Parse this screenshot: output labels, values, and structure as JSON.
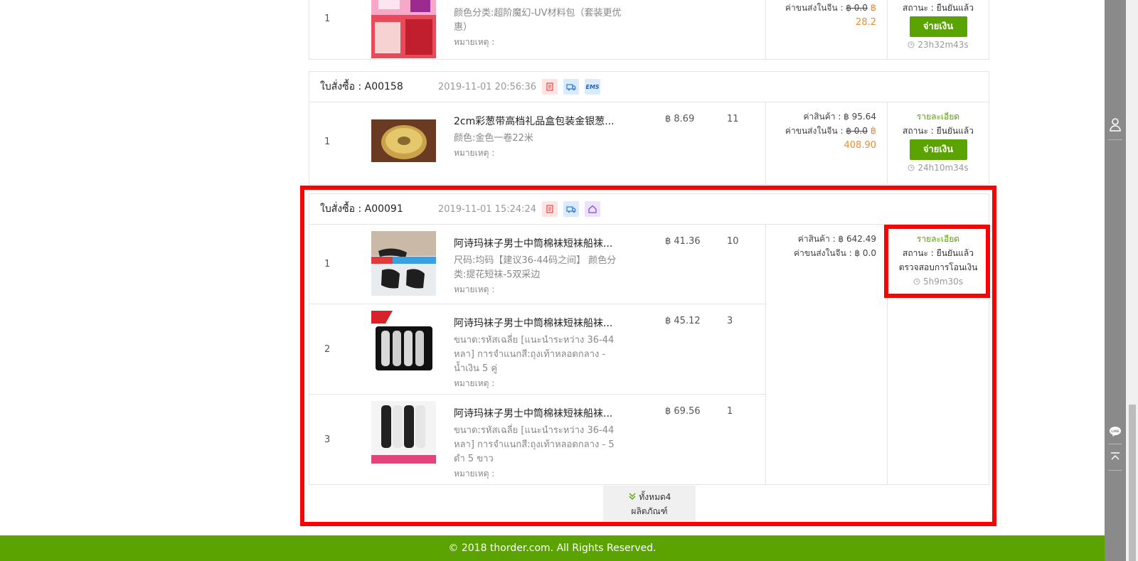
{
  "orders": [
    {
      "items": [
        {
          "index": "1",
          "attr": "颜色分类:超阶魔幻-UV材料包（套装更优惠）",
          "note": "หมายเหตุ :"
        }
      ],
      "amount": {
        "shipping_label": "ค่าขนส่งในจีน :",
        "shipping_old": "฿ 0.0",
        "shipping_currency": "฿",
        "shipping_new": "28.2"
      },
      "status": {
        "label": "สถานะ : ยืนยันแล้ว",
        "pay": "จ่ายเงิน",
        "timer": "23h32m43s"
      }
    },
    {
      "order_no": "ใบสั่งซื้อ : A00158",
      "date": "2019-11-01 20:56:36",
      "badges": [
        "invoice-icon",
        "truck-icon",
        "EMS"
      ],
      "items": [
        {
          "index": "1",
          "name": "2cm彩葱带高档礼品盒包装金银葱...",
          "price": "฿ 8.69",
          "qty": "11",
          "attr": "颜色:金色一卷22米",
          "note": "หมายเหตุ :"
        }
      ],
      "amount": {
        "goods_label": "ค่าสินค้า : ฿ 95.64",
        "shipping_label": "ค่าขนส่งในจีน :",
        "shipping_old": "฿ 0.0",
        "shipping_currency": "฿",
        "shipping_new": "408.90"
      },
      "status": {
        "detail": "รายละเอียด",
        "label": "สถานะ : ยืนยันแล้ว",
        "pay": "จ่ายเงิน",
        "timer": "24h10m34s"
      }
    },
    {
      "order_no": "ใบสั่งซื้อ : A00091",
      "date": "2019-11-01 15:24:24",
      "badges": [
        "invoice-icon",
        "truck-icon",
        "home-icon"
      ],
      "items": [
        {
          "index": "1",
          "name": "阿诗玛袜子男士中筒棉袜短袜船袜...",
          "price": "฿ 41.36",
          "qty": "10",
          "attr": "尺码:均码【建议36-44码之间】        颜色分类:提花短袜-5双采边",
          "note": "หมายเหตุ :"
        },
        {
          "index": "2",
          "name": "阿诗玛袜子男士中筒棉袜短袜船袜...",
          "price": "฿ 45.12",
          "qty": "3",
          "attr": "ขนาด:รหัสเฉลี่ย [แนะนำระหว่าง 36-44 หลา]        การจำแนกสี:ถุงเท้าหลอดกลาง - น้ำเงิน 5 คู่",
          "note": "หมายเหตุ :"
        },
        {
          "index": "3",
          "name": "阿诗玛袜子男士中筒棉袜短袜船袜...",
          "price": "฿ 69.56",
          "qty": "1",
          "attr": "ขนาด:รหัสเฉลี่ย [แนะนำระหว่าง 36-44 หลา]        การจำแนกสี:ถุงเท้าหลอดกลาง - 5 ดำ 5 ขาว",
          "note": "หมายเหตุ :"
        }
      ],
      "amount": {
        "goods_label": "ค่าสินค้า : ฿ 642.49",
        "shipping_plain": "ค่าขนส่งในจีน : ฿ 0.0"
      },
      "status": {
        "detail": "รายละเอียด",
        "label": "สถานะ : ยืนยันแล้ว",
        "verify": "ตรวจสอบการโอนเงิน",
        "timer": "5h9m30s"
      },
      "more": {
        "line1": "ทั้งหมด4",
        "line2": "ผลิตภัณฑ์"
      }
    }
  ],
  "footer": "© 2018 thorder.com. All Rights Reserved.",
  "colors": {
    "accent_green": "#5aa300",
    "price_orange": "#f08c2a",
    "highlight_red": "#ff0000"
  }
}
